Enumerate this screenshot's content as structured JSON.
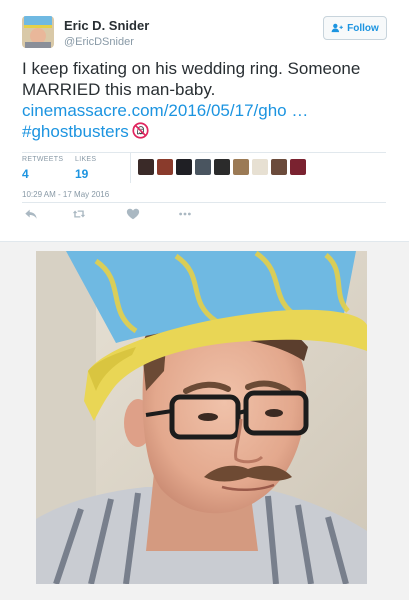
{
  "author": {
    "display_name": "Eric D. Snider",
    "handle": "@EricDSnider"
  },
  "follow_button": {
    "label": "Follow"
  },
  "tweet": {
    "text": "I keep fixating on his wedding ring. Someone MARRIED this man-baby.",
    "link": "cinemassacre.com/2016/05/17/gho …",
    "hashtag": "#ghostbusters"
  },
  "stats": {
    "retweets_label": "RETWEETS",
    "retweets": "4",
    "likes_label": "LIKES",
    "likes": "19"
  },
  "liker_avatars": [
    {
      "color": "#3a2a28"
    },
    {
      "color": "#8a3b2c"
    },
    {
      "color": "#1f1f24"
    },
    {
      "color": "#4a5560"
    },
    {
      "color": "#2b2b2b"
    },
    {
      "color": "#9b7a55"
    },
    {
      "color": "#e7e0d2"
    },
    {
      "color": "#6b4b3b"
    },
    {
      "color": "#7a2230"
    }
  ],
  "timestamp": "10:29 AM - 17 May 2016",
  "colors": {
    "accent": "#1c94e0",
    "hat_blue": "#6fb9e2",
    "hat_yellow": "#e5d04a"
  },
  "icons": {
    "reply": "reply-icon",
    "retweet": "retweet-icon",
    "like": "heart-icon",
    "more": "more-dots-icon",
    "follow": "add-person-icon",
    "ghostbusters": "no-ghost-emoji"
  }
}
